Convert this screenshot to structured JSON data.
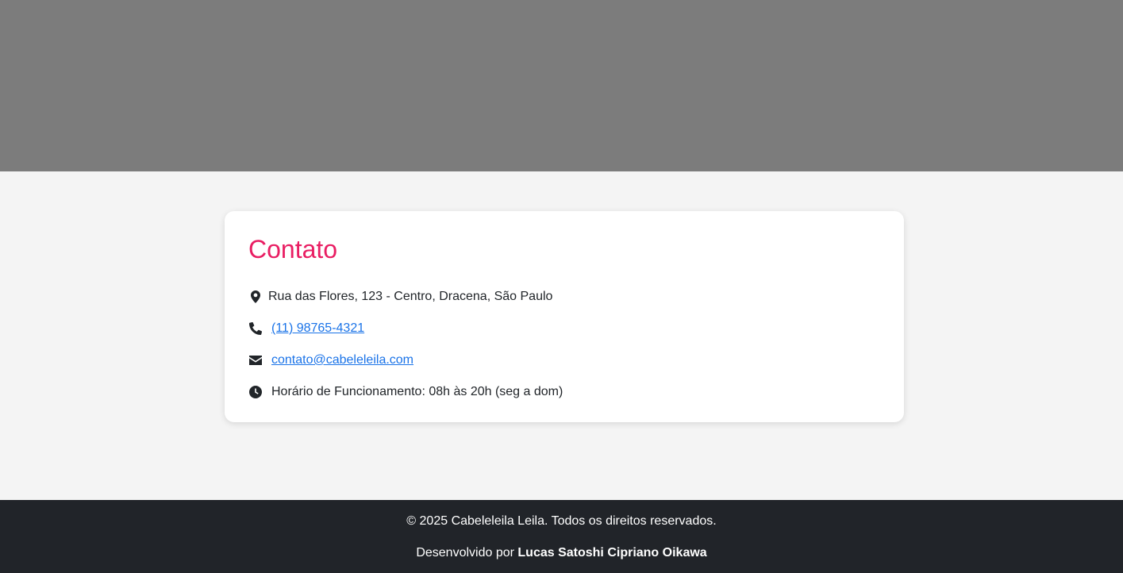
{
  "contact": {
    "title": "Contato",
    "address": "Rua das Flores, 123 - Centro, Dracena, São Paulo",
    "phone": "(11) 98765-4321",
    "email": "contato@cabeleleila.com",
    "hours": "Horário de Funcionamento: 08h às 20h (seg a dom)"
  },
  "footer": {
    "copyright": "© 2025 Cabeleleila Leila. Todos os direitos reservados.",
    "developed_by_prefix": "Desenvolvido por ",
    "developer_name": "Lucas Satoshi Cipriano Oikawa"
  },
  "icons": {
    "address": "map-marker-icon",
    "phone": "phone-icon",
    "email": "envelope-icon",
    "hours": "clock-icon"
  },
  "colors": {
    "hero_bg": "#7c7c7c",
    "page_bg": "#f4f4f4",
    "title": "#e91e63",
    "link": "#1a73e8",
    "footer_bg": "#212429"
  }
}
